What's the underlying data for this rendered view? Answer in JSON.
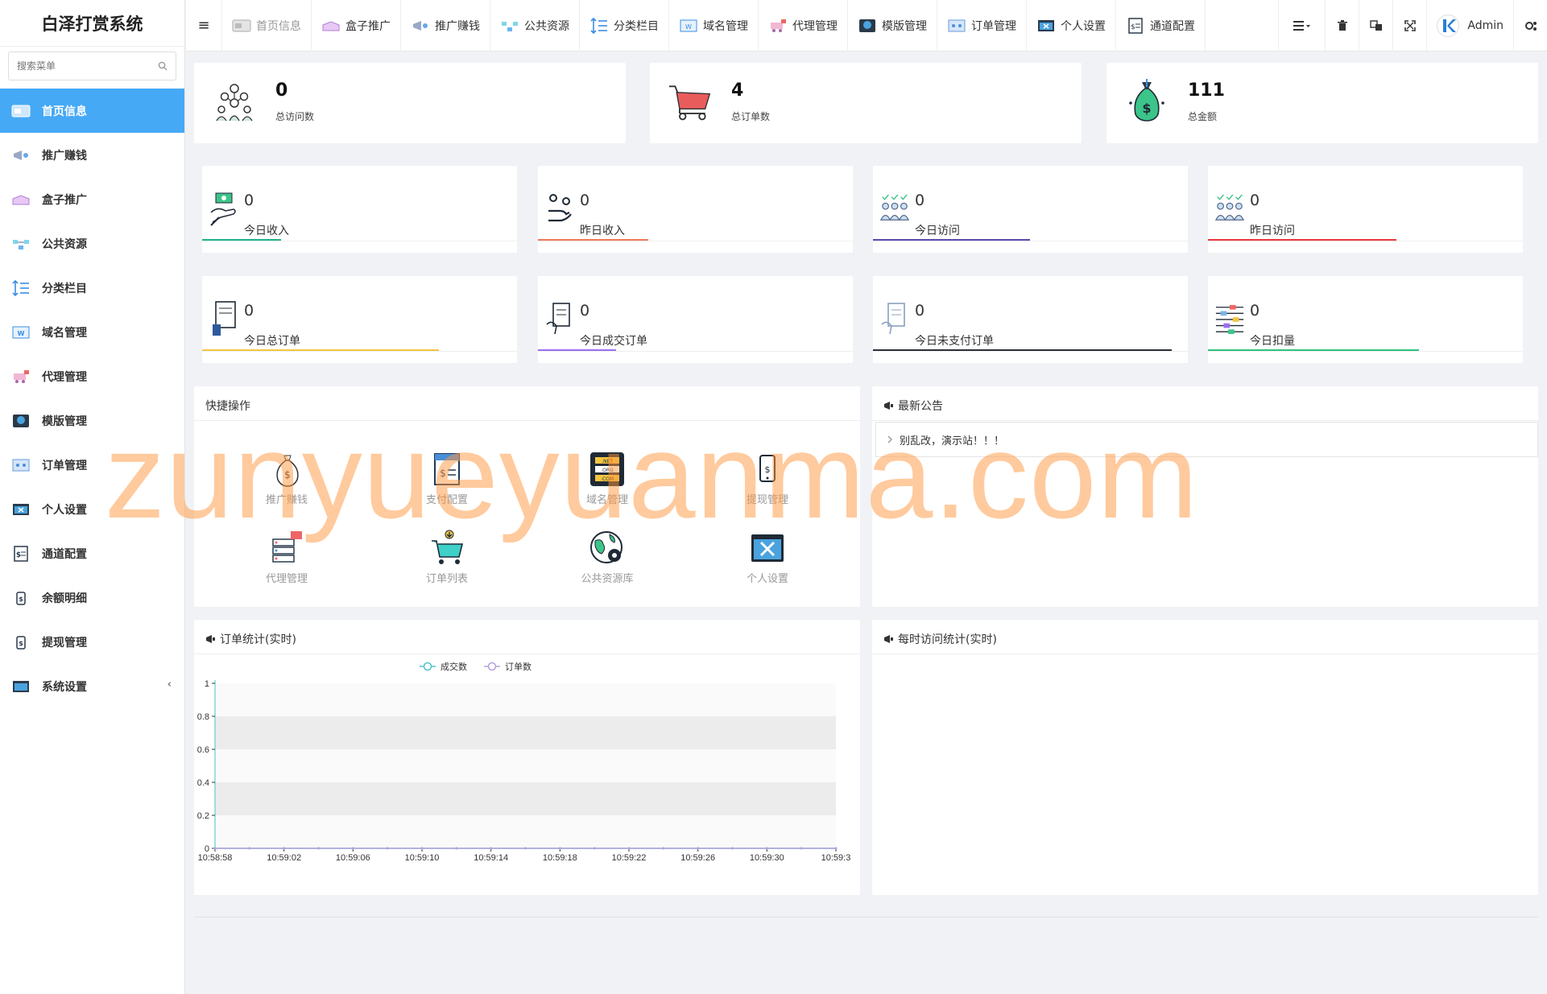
{
  "sidebar": {
    "logo": "白泽打赏系统",
    "search_placeholder": "搜索菜单",
    "items": [
      {
        "label": "首页信息",
        "icon": "browser-icon",
        "active": true
      },
      {
        "label": "推广赚钱",
        "icon": "megaphone-icon"
      },
      {
        "label": "盒子推广",
        "icon": "box-icon"
      },
      {
        "label": "公共资源",
        "icon": "network-icon"
      },
      {
        "label": "分类栏目",
        "icon": "sort-list-icon"
      },
      {
        "label": "域名管理",
        "icon": "web-window-icon"
      },
      {
        "label": "代理管理",
        "icon": "cart-agent-icon"
      },
      {
        "label": "模版管理",
        "icon": "html-globe-icon"
      },
      {
        "label": "订单管理",
        "icon": "order-network-icon"
      },
      {
        "label": "个人设置",
        "icon": "settings-window-icon"
      },
      {
        "label": "通道配置",
        "icon": "channel-config-icon"
      },
      {
        "label": "余额明细",
        "icon": "balance-icon"
      },
      {
        "label": "提现管理",
        "icon": "withdraw-icon"
      },
      {
        "label": "系统设置",
        "icon": "system-window-icon",
        "arrow": "‹"
      }
    ]
  },
  "topbar": {
    "menu_icon": "≡",
    "tabs": [
      {
        "label": "首页信息"
      },
      {
        "label": "盒子推广"
      },
      {
        "label": "推广赚钱"
      },
      {
        "label": "公共资源"
      },
      {
        "label": "分类栏目"
      },
      {
        "label": "域名管理"
      },
      {
        "label": "代理管理"
      },
      {
        "label": "模版管理"
      },
      {
        "label": "订单管理"
      },
      {
        "label": "个人设置"
      },
      {
        "label": "通道配置"
      }
    ],
    "user": "Admin"
  },
  "summary": [
    {
      "value": "0",
      "label": "总访问数"
    },
    {
      "value": "4",
      "label": "总订单数"
    },
    {
      "value": "111",
      "label": "总金额"
    }
  ],
  "stats": [
    {
      "value": "0",
      "label": "今日收入",
      "color": "#1fb38a"
    },
    {
      "value": "0",
      "label": "昨日收入",
      "color": "#f0795a"
    },
    {
      "value": "0",
      "label": "今日访问",
      "color": "#5c4bb0"
    },
    {
      "value": "0",
      "label": "昨日访问",
      "color": "#e8383d"
    },
    {
      "value": "0",
      "label": "今日总订单",
      "color": "#f5c542"
    },
    {
      "value": "0",
      "label": "今日成交订单",
      "color": "#9b6df2"
    },
    {
      "value": "0",
      "label": "今日未支付订单",
      "color": "#2c2f3a"
    },
    {
      "value": "0",
      "label": "今日扣量",
      "color": "#2ec27e"
    }
  ],
  "quick": {
    "title": "快捷操作",
    "items": [
      {
        "label": "推广赚钱"
      },
      {
        "label": "支付配置"
      },
      {
        "label": "域名管理"
      },
      {
        "label": "提现管理"
      },
      {
        "label": "代理管理"
      },
      {
        "label": "订单列表"
      },
      {
        "label": "公共资源库"
      },
      {
        "label": "个人设置"
      }
    ]
  },
  "notice": {
    "title": "最新公告",
    "text": "别乱改，演示站！！！"
  },
  "order_chart_title": "订单统计(实时)",
  "visit_chart_title": "每时访问统计(实时)",
  "watermark": "zunyueyuanma.com",
  "colors": {
    "accent": "#46a9f5",
    "series_deal": "#4ec3c8",
    "series_order": "#b6a2de"
  },
  "chart_data": {
    "type": "line",
    "title": "订单统计(实时)",
    "x": [
      "10:58:58",
      "10:59:00",
      "10:59:02",
      "10:59:04",
      "10:59:06",
      "10:59:08",
      "10:59:10",
      "10:59:12",
      "10:59:14",
      "10:59:16",
      "10:59:18",
      "10:59:20",
      "10:59:22",
      "10:59:24",
      "10:59:26",
      "10:59:28",
      "10:59:30",
      "10:59:32",
      "10:59:34"
    ],
    "xticks": [
      "10:58:58",
      "10:59:02",
      "10:59:06",
      "10:59:10",
      "10:59:14",
      "10:59:18",
      "10:59:22",
      "10:59:26",
      "10:59:30",
      "10:59:3"
    ],
    "series": [
      {
        "name": "成交数",
        "values": [
          0,
          0,
          0,
          0,
          0,
          0,
          0,
          0,
          0,
          0,
          0,
          0,
          0,
          0,
          0,
          0,
          0,
          0,
          0
        ]
      },
      {
        "name": "订单数",
        "values": [
          0,
          0,
          0,
          0,
          0,
          0,
          0,
          0,
          0,
          0,
          0,
          0,
          0,
          0,
          0,
          0,
          0,
          0,
          0
        ]
      }
    ],
    "yticks": [
      "0",
      "0.2",
      "0.4",
      "0.6",
      "0.8",
      "1"
    ],
    "ylim": [
      0,
      1
    ],
    "legend": "top-center",
    "grid": "alternating-bands"
  }
}
